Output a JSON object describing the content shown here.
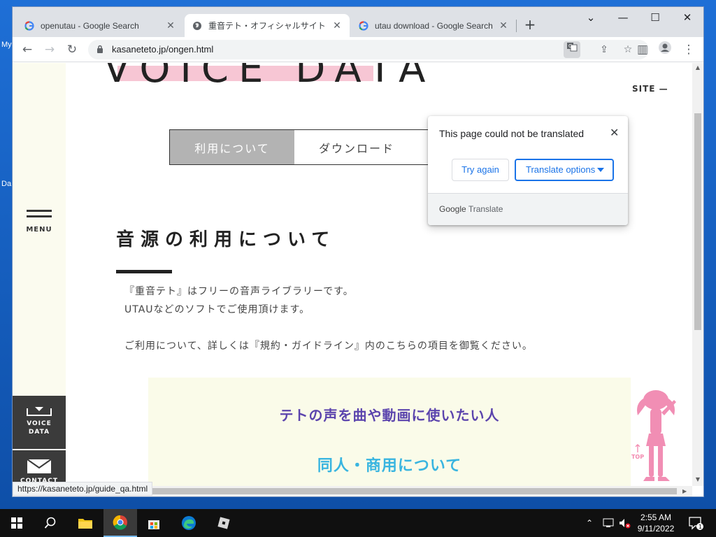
{
  "desktop": {
    "label_top": "My",
    "label_mid": "Da"
  },
  "browser": {
    "tabs": [
      {
        "title": "openutau - Google Search",
        "favicon": "google-icon"
      },
      {
        "title": "重音テト・オフィシャルサイト",
        "favicon": "globe-icon",
        "active": true
      },
      {
        "title": "utau download - Google Search",
        "favicon": "google-icon"
      }
    ],
    "new_tab": "+",
    "url": "kasaneteto.jp/ongen.html",
    "status_url": "https://kasaneteto.jp/guide_qa.html"
  },
  "page": {
    "hero": "VOICE DATA",
    "site_tag": "SITE",
    "menu_label": "MENU",
    "nav_tabs": [
      "利用について",
      "ダウンロード"
    ],
    "heading": "音源の利用について",
    "paragraphs": [
      "『重音テト』はフリーの音声ライブラリーです。",
      "UTAUなどのソフトでご使用頂けます。",
      "ご利用について、詳しくは『規約・ガイドライン』内のこちらの項目を御覧ください。"
    ],
    "link1": "テトの声を曲や動画に使いたい人",
    "link2": "同人・商用について",
    "side_voice": [
      "VOICE",
      "DATA"
    ],
    "side_contact": "CONTACT",
    "top_label": "TOP"
  },
  "translate_popup": {
    "message": "This page could not be translated",
    "try_again": "Try again",
    "options": "Translate options",
    "brand_google": "Google",
    "brand_translate": "Translate"
  },
  "taskbar": {
    "time": "2:55 AM",
    "date": "9/11/2022",
    "notification_count": "1"
  },
  "colors": {
    "accent_blue": "#1a73e8",
    "link_purple": "#5b44ad",
    "link_cyan": "#39b5e0",
    "highlight_pink": "#f7c6d4"
  }
}
